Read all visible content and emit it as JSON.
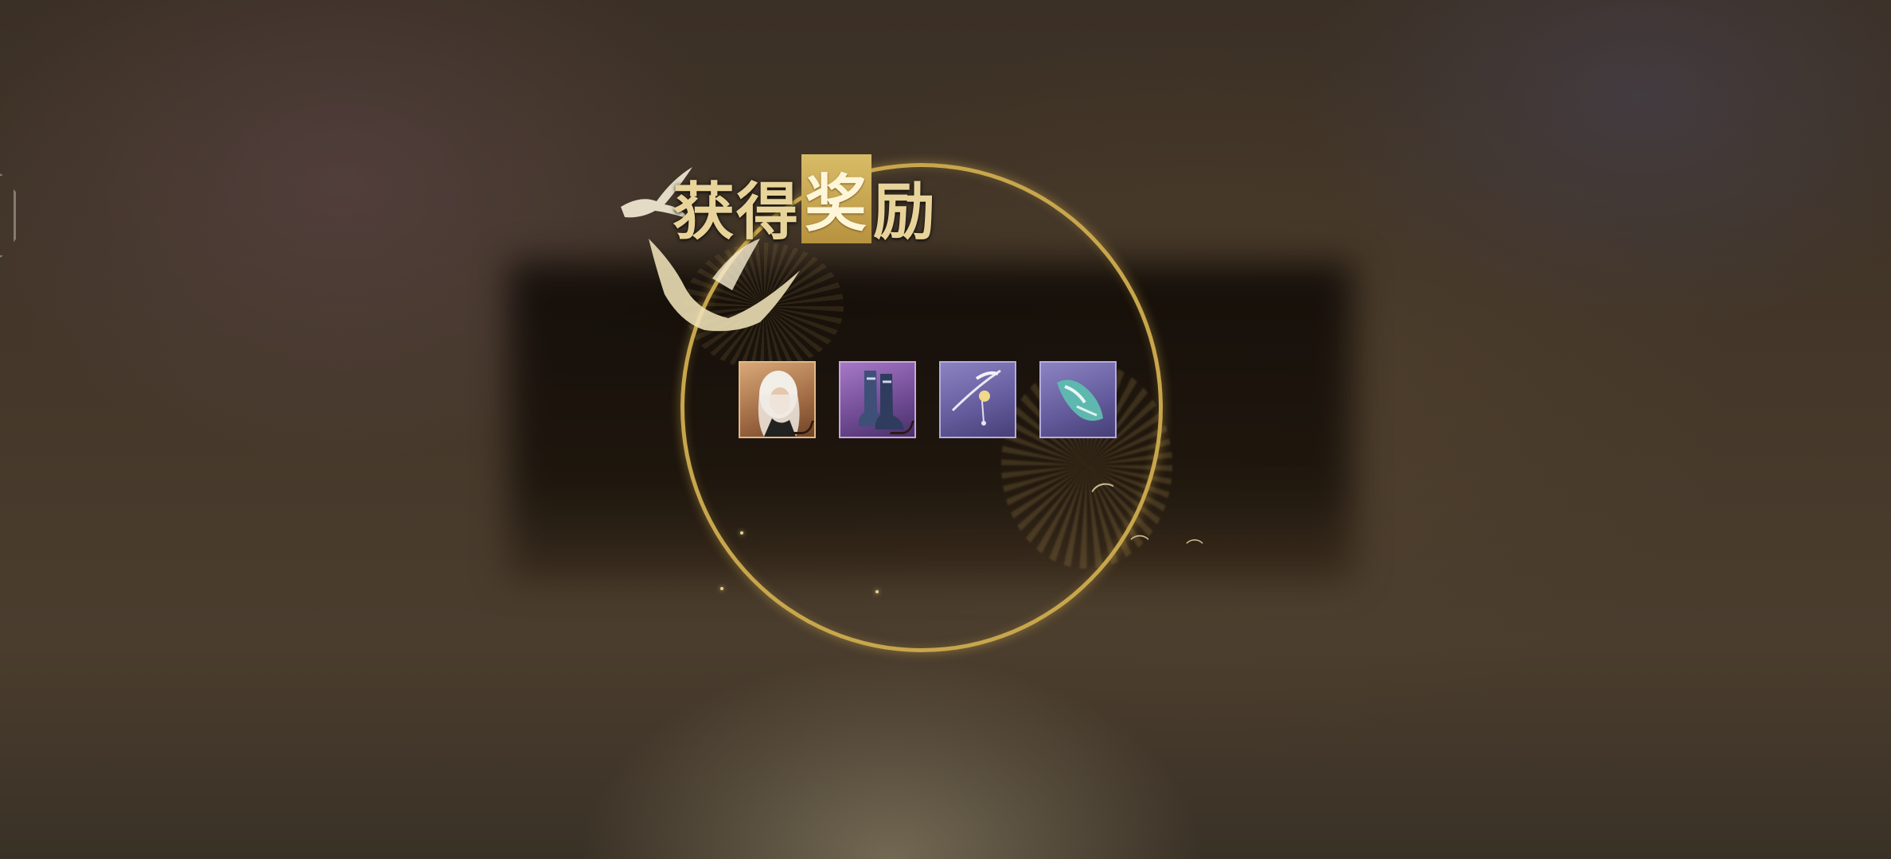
{
  "reward_panel": {
    "title_part1": "获得",
    "title_highlight": "奖",
    "title_part2": "励",
    "items": [
      {
        "icon": "character-portrait-icon",
        "rarity_color": "#d9a877"
      },
      {
        "icon": "boots-icon",
        "rarity_color": "#a678c6"
      },
      {
        "icon": "hairpin-icon",
        "rarity_color": "#8b83c2"
      },
      {
        "icon": "gauntlet-icon",
        "rarity_color": "#8b83c2"
      }
    ]
  },
  "colors": {
    "gold_accent": "#c8a64c",
    "title_text": "#e8d49a"
  }
}
